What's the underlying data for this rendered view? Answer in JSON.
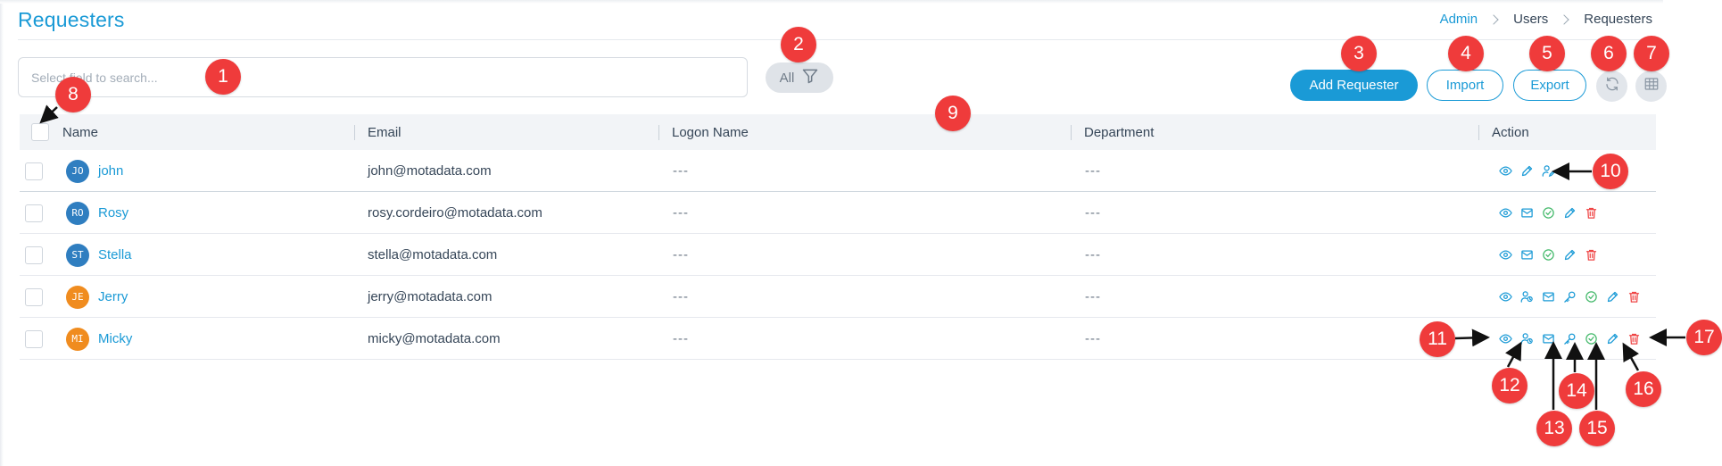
{
  "header": {
    "title": "Requesters",
    "breadcrumb": [
      "Admin",
      "Users",
      "Requesters"
    ]
  },
  "toolbar": {
    "search_placeholder": "Select field to search...",
    "filter_label": "All",
    "add_label": "Add Requester",
    "import_label": "Import",
    "export_label": "Export"
  },
  "table": {
    "columns": [
      "Name",
      "Email",
      "Logon Name",
      "Department",
      "Action"
    ],
    "rows": [
      {
        "initials": "JO",
        "avatar_color": "#2f7ec0",
        "name": "john",
        "email": "john@motadata.com",
        "logon": "---",
        "department": "---",
        "actions": [
          "view-icon",
          "edit-icon",
          "convert-user-icon"
        ]
      },
      {
        "initials": "RO",
        "avatar_color": "#2f7ec0",
        "name": "Rosy",
        "email": "rosy.cordeiro@motadata.com",
        "logon": "---",
        "department": "---",
        "actions": [
          "view-icon",
          "email-icon",
          "check-icon",
          "edit-icon",
          "delete-icon"
        ]
      },
      {
        "initials": "ST",
        "avatar_color": "#2f7ec0",
        "name": "Stella",
        "email": "stella@motadata.com",
        "logon": "---",
        "department": "---",
        "actions": [
          "view-icon",
          "email-icon",
          "check-icon",
          "edit-icon",
          "delete-icon"
        ]
      },
      {
        "initials": "JE",
        "avatar_color": "#f08c1f",
        "name": "Jerry",
        "email": "jerry@motadata.com",
        "logon": "---",
        "department": "---",
        "actions": [
          "view-icon",
          "user-group-icon",
          "email-icon",
          "key-icon",
          "check-icon",
          "edit-icon",
          "delete-icon"
        ]
      },
      {
        "initials": "MI",
        "avatar_color": "#f08c1f",
        "name": "Micky",
        "email": "micky@motadata.com",
        "logon": "---",
        "department": "---",
        "actions": [
          "view-icon",
          "user-group-icon",
          "email-icon",
          "key-icon",
          "check-icon",
          "edit-icon",
          "delete-icon"
        ]
      }
    ]
  },
  "annotations": [
    "1",
    "2",
    "3",
    "4",
    "5",
    "6",
    "7",
    "8",
    "9",
    "10",
    "11",
    "12",
    "13",
    "14",
    "15",
    "16",
    "17"
  ],
  "colors": {
    "accent": "#1a9ad6",
    "success": "#43b96a",
    "danger": "#ef4444",
    "badge": "#ef3b3b"
  }
}
